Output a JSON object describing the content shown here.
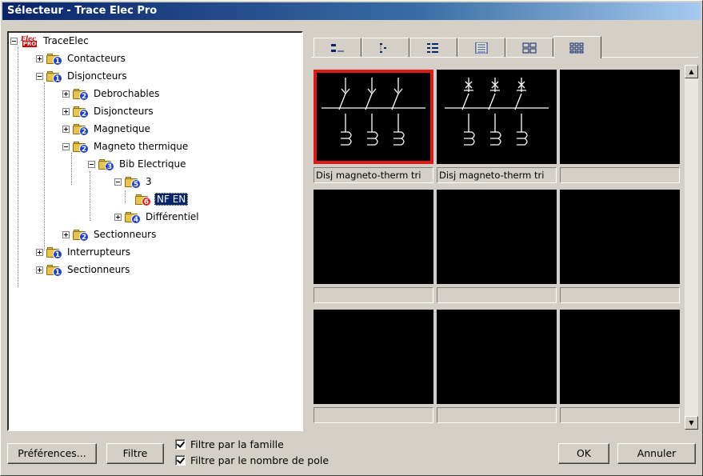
{
  "window": {
    "title": "Sélecteur - Trace Elec Pro"
  },
  "tree": {
    "root": {
      "label": "TraceElec",
      "logo_top": "Elec",
      "logo_bottom": "PRO"
    },
    "nodes": [
      {
        "label": "Contacteurs",
        "badge": "1"
      },
      {
        "label": "Disjoncteurs",
        "badge": "1"
      },
      {
        "label": "Debrochables",
        "badge": "2"
      },
      {
        "label": "Disjoncteurs",
        "badge": "2"
      },
      {
        "label": "Magnetique",
        "badge": "2"
      },
      {
        "label": "Magneto thermique",
        "badge": "2"
      },
      {
        "label": "Bib Electrique",
        "badge": "3"
      },
      {
        "label": "3",
        "badge": "5"
      },
      {
        "label": "NF EN",
        "badge": "6"
      },
      {
        "label": "Différentiel",
        "badge": "4"
      },
      {
        "label": "Sectionneurs",
        "badge": "2"
      },
      {
        "label": "Interrupteurs",
        "badge": "1"
      },
      {
        "label": "Sectionneurs",
        "badge": "1"
      }
    ]
  },
  "view_tabs": [
    "list-view-icon",
    "tree-view-icon",
    "detail-view-icon",
    "report-view-icon",
    "large-grid-icon",
    "small-grid-icon"
  ],
  "grid": {
    "captions": [
      "Disj magneto-therm tri",
      "Disj magneto-therm tri",
      "",
      "",
      "",
      "",
      "",
      "",
      ""
    ]
  },
  "footer": {
    "preferences_label": "Préférences...",
    "filter_label": "Filtre",
    "check_family_label": "Filtre par la famille",
    "check_poles_label": "Filtre par le nombre de pole",
    "ok_label": "OK",
    "cancel_label": "Annuler"
  }
}
